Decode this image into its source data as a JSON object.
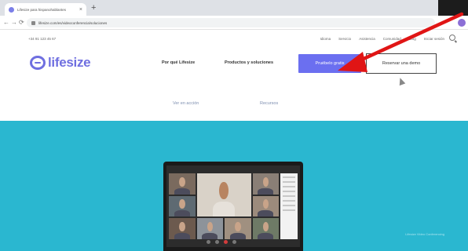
{
  "browser": {
    "tab_title": "Lifesize para hispanohablantes",
    "tab_close": "×",
    "new_tab": "+",
    "url": "lifesize.com/es/videoconferencia/soluciones",
    "nav_back": "←",
    "nav_forward": "→",
    "nav_reload": "⟳"
  },
  "utility_bar": {
    "phone": "+34 91 123 45 67",
    "links": [
      "Idioma",
      "Servicio",
      "Asistencia",
      "Comunidad",
      "Blog",
      "Iniciar sesión"
    ]
  },
  "header": {
    "logo_text": "lifesize",
    "menu": [
      "Por qué Lifesize",
      "Productos y soluciones"
    ],
    "cta_primary": "Pruébelo gratis",
    "cta_secondary": "Reservar una demo"
  },
  "sub_nav": {
    "links": [
      "Ver en acción",
      "Recursos"
    ]
  },
  "hero": {
    "note": "Lifesize Video Conferencing"
  },
  "colors": {
    "brand": "#6f6fe0",
    "cta": "#6b6ff0",
    "hero_bg": "#2ab7d0",
    "annotation_arrow": "#e01515"
  },
  "icons": {
    "logo": "lifesize-logo-icon",
    "search": "search-icon",
    "arrow": "red-arrow-annotation"
  }
}
